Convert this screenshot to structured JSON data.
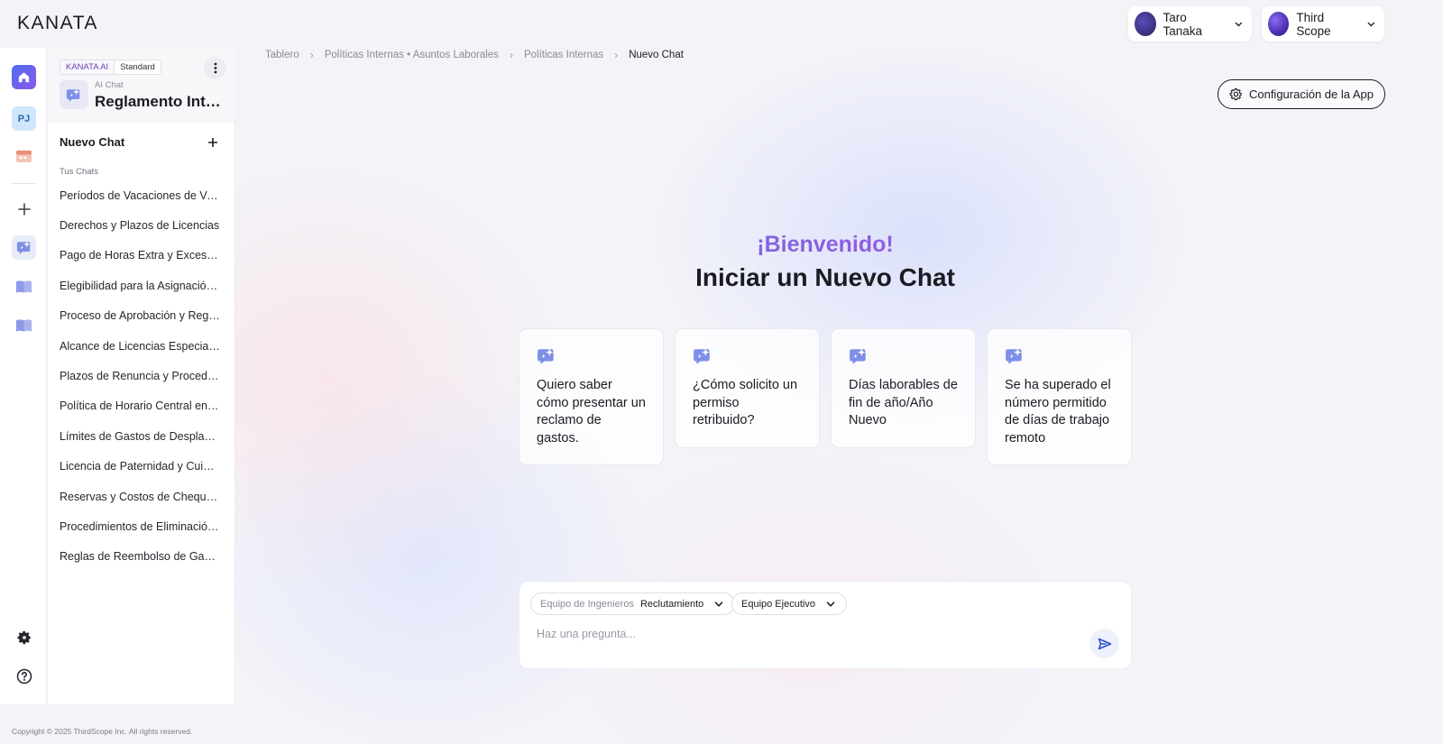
{
  "brand": {
    "logo": "KANATA"
  },
  "header": {
    "user": {
      "name": "Taro Tanaka",
      "avatar_color": "#3a2d8a"
    },
    "org": {
      "name": "Third Scope",
      "avatar_color": "#6b4de0"
    }
  },
  "rail": {
    "items": [
      {
        "name": "home-icon",
        "active": true
      },
      {
        "name": "project-badge",
        "label": "PJ"
      },
      {
        "name": "calendar-icon"
      },
      {
        "name": "add-icon"
      },
      {
        "name": "ai-chat-icon"
      },
      {
        "name": "book-icon"
      },
      {
        "name": "book-icon-2"
      }
    ],
    "bottom": [
      "gear-icon",
      "help-icon"
    ]
  },
  "sidebar": {
    "tag_ai": "KANATA AI",
    "tag_plan": "Standard",
    "app_subtitle": "AI Chat",
    "app_title": "Reglamento Interno",
    "new_chat_label": "Nuevo Chat",
    "section_label": "Tus Chats",
    "chats": [
      "Períodos de Vacaciones de Verano",
      "Derechos y Plazos de Licencias",
      "Pago de Horas Extra y Exceso de Jornada",
      "Elegibilidad para la Asignación Familiar",
      "Proceso de Aprobación y Reglamento",
      "Alcance de Licencias Especiales",
      "Plazos de Renuncia y Procedimientos",
      "Política de Horario Central en Flextime",
      "Límites de Gastos de Desplazamiento",
      "Licencia de Paternidad y Cuidado",
      "Reservas y Costos de Chequeos Médicos",
      "Procedimientos de Eliminación de Datos",
      "Reglas de Reembolso de Gastos"
    ]
  },
  "breadcrumb": {
    "items": [
      "Tablero",
      "Políticas Internas • Asuntos Laborales",
      "Políticas Internas"
    ],
    "current": "Nuevo Chat"
  },
  "config_button": "Configuración de la App",
  "main": {
    "welcome": "¡Bienvenido!",
    "headline": "Iniciar un Nuevo Chat",
    "suggestions": [
      "Quiero saber cómo presentar un reclamo de gastos.",
      "¿Cómo solicito un permiso retribuido?",
      "Días laborables de fin de año/Año Nuevo",
      "Se ha superado el número permitido de días de trabajo remoto"
    ]
  },
  "composer": {
    "select1_label": "Equipo de Ingenieros",
    "select1_value": "Reclutamiento",
    "select2_value": "Equipo Ejecutivo",
    "placeholder": "Haz una pregunta..."
  },
  "footer": {
    "copyright": "Copyright © 2025 ThirdScope Inc. All rights reserved."
  },
  "colors": {
    "accent": "#6b4de0",
    "brand_blue": "#3b5bdb",
    "text": "#1b1b22"
  }
}
